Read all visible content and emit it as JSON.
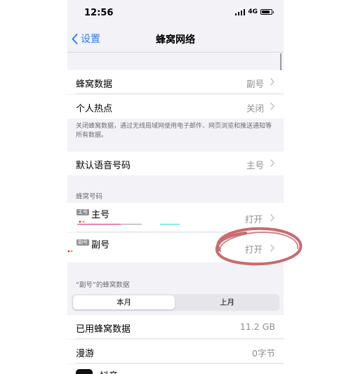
{
  "status_bar": {
    "time": "12:56",
    "network": "4G"
  },
  "nav": {
    "back_label": "设置",
    "title": "蜂窝网络"
  },
  "group1": {
    "rows": [
      {
        "label": "蜂窝数据",
        "value": "副号"
      },
      {
        "label": "个人热点",
        "value": "关闭"
      }
    ],
    "footnote": "关闭蜂窝数据，通过无线局域网使用电子邮件、网页浏览和推送通知等所有数据。"
  },
  "default_voice": {
    "label": "默认语音号码",
    "value": "主号"
  },
  "sims": {
    "header": "蜂窝号码",
    "items": [
      {
        "badge": "主号",
        "name": "主号",
        "value": "打开"
      },
      {
        "badge": "副号",
        "name": "副号",
        "value": "打开"
      }
    ]
  },
  "usage": {
    "header": "“副号”的蜂窝数据",
    "segments": [
      "本月",
      "上月"
    ],
    "selected_segment": "本月",
    "rows": [
      {
        "label": "已用蜂窝数据",
        "value": "11.2 GB"
      },
      {
        "label": "漫游",
        "value": "0字节"
      }
    ],
    "app_row": {
      "label": "抖音"
    }
  },
  "colors": {
    "accent": "#2f7cf6",
    "background": "#f2f2f7",
    "annotation_circle": "#c96b6f",
    "redaction_colors": [
      "#e0245e",
      "#9e9ea3",
      "#2ad4d4"
    ]
  }
}
